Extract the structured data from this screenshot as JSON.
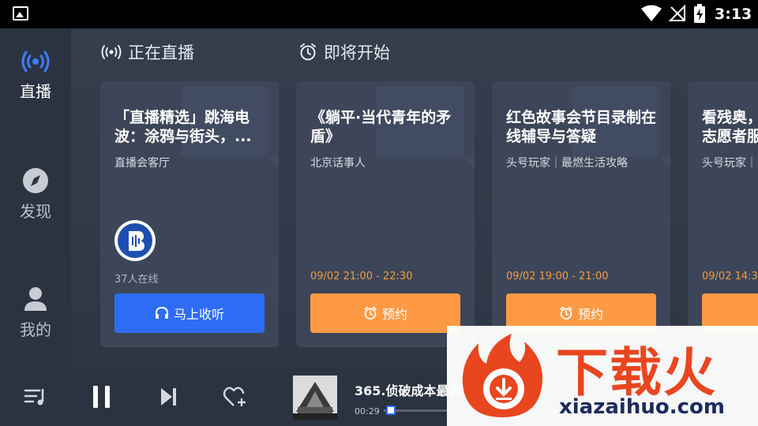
{
  "status_bar": {
    "time": "3:13"
  },
  "sidebar": {
    "items": [
      {
        "label": "直播",
        "icon": "live-broadcast-icon",
        "active": true
      },
      {
        "label": "发现",
        "icon": "compass-icon",
        "active": false
      },
      {
        "label": "我的",
        "icon": "user-icon",
        "active": false
      }
    ]
  },
  "sections": {
    "live": {
      "title": "正在直播",
      "icon": "broadcast-icon"
    },
    "upcoming": {
      "title": "即将开始",
      "icon": "alarm-clock-icon"
    }
  },
  "cards": [
    {
      "title": "「直播精选」跳海电波：涂鸦与街头，...",
      "subtitle": "直播会客厅",
      "online": "37人在线",
      "button": "马上收听",
      "kind": "live"
    },
    {
      "title": "《躺平·当代青年的矛盾》",
      "subtitle": "北京话事人",
      "time": "09/02 21:00 - 22:30",
      "button": "预约",
      "kind": "upcoming"
    },
    {
      "title": "红色故事会节目录制在线辅导与答疑",
      "subtitle": "头号玩家｜最燃生活攻略",
      "time": "09/02 19:00 - 21:00",
      "button": "预约",
      "kind": "upcoming"
    },
    {
      "title": "看残奥，志愿者服",
      "subtitle": "头号玩家｜",
      "time": "09/02 14:30",
      "button": "",
      "kind": "upcoming"
    }
  ],
  "player": {
    "title": "365.侦破成本最贵的案",
    "elapsed": "00:29",
    "progress_fraction": 0.02
  },
  "watermark": {
    "text": "下载火",
    "url": "xiazaihuo.com"
  },
  "colors": {
    "accent_blue": "#2f6cf6",
    "accent_orange": "#ff9a44",
    "time_orange": "#f29b42"
  }
}
